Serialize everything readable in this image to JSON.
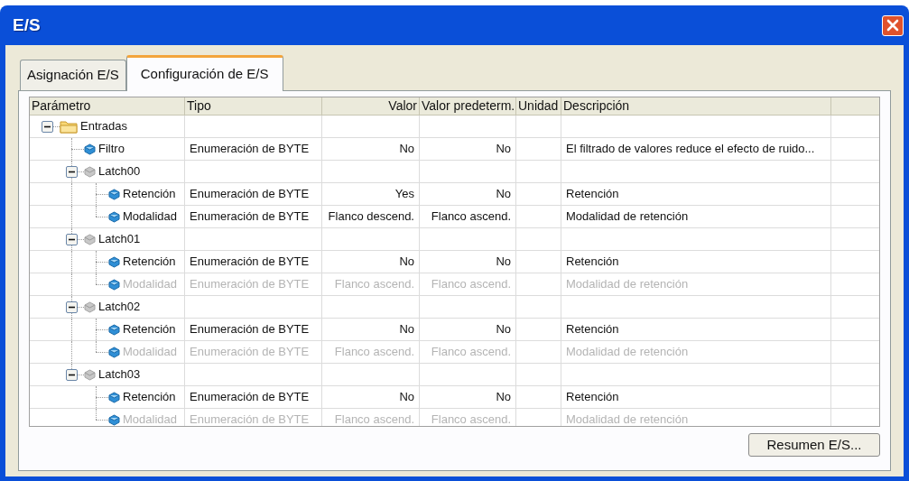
{
  "window": {
    "title": "E/S"
  },
  "tabs": [
    {
      "label": "Asignación E/S",
      "selected": false
    },
    {
      "label": "Configuración de E/S",
      "selected": true
    }
  ],
  "table": {
    "columns": [
      "Parámetro",
      "Tipo",
      "Valor",
      "Valor predeterm.",
      "Unidad",
      "Descripción"
    ],
    "rows": [
      {
        "kind": "folder",
        "name": "Entradas",
        "expanded": true,
        "children": [
          {
            "kind": "param",
            "name": "Filtro",
            "type": "Enumeración de BYTE",
            "value": "No",
            "default": "No",
            "description": "El filtrado de valores reduce el efecto de ruido...",
            "disabled": false
          },
          {
            "kind": "group",
            "name": "Latch00",
            "expanded": true,
            "children": [
              {
                "kind": "param",
                "name": "Retención",
                "type": "Enumeración de BYTE",
                "value": "Yes",
                "default": "No",
                "description": "Retención",
                "disabled": false
              },
              {
                "kind": "param",
                "name": "Modalidad",
                "type": "Enumeración de BYTE",
                "value": "Flanco descend.",
                "default": "Flanco ascend.",
                "description": "Modalidad de retención",
                "disabled": false
              }
            ]
          },
          {
            "kind": "group",
            "name": "Latch01",
            "expanded": true,
            "children": [
              {
                "kind": "param",
                "name": "Retención",
                "type": "Enumeración de BYTE",
                "value": "No",
                "default": "No",
                "description": "Retención",
                "disabled": false
              },
              {
                "kind": "param",
                "name": "Modalidad",
                "type": "Enumeración de BYTE",
                "value": "Flanco ascend.",
                "default": "Flanco ascend.",
                "description": "Modalidad de retención",
                "disabled": true
              }
            ]
          },
          {
            "kind": "group",
            "name": "Latch02",
            "expanded": true,
            "children": [
              {
                "kind": "param",
                "name": "Retención",
                "type": "Enumeración de BYTE",
                "value": "No",
                "default": "No",
                "description": "Retención",
                "disabled": false
              },
              {
                "kind": "param",
                "name": "Modalidad",
                "type": "Enumeración de BYTE",
                "value": "Flanco ascend.",
                "default": "Flanco ascend.",
                "description": "Modalidad de retención",
                "disabled": true
              }
            ]
          },
          {
            "kind": "group",
            "name": "Latch03",
            "expanded": true,
            "children": [
              {
                "kind": "param",
                "name": "Retención",
                "type": "Enumeración de BYTE",
                "value": "No",
                "default": "No",
                "description": "Retención",
                "disabled": false
              },
              {
                "kind": "param",
                "name": "Modalidad",
                "type": "Enumeración de BYTE",
                "value": "Flanco ascend.",
                "default": "Flanco ascend.",
                "description": "Modalidad de retención",
                "disabled": true
              }
            ]
          }
        ]
      }
    ]
  },
  "buttons": [
    "Resumen E/S..."
  ]
}
